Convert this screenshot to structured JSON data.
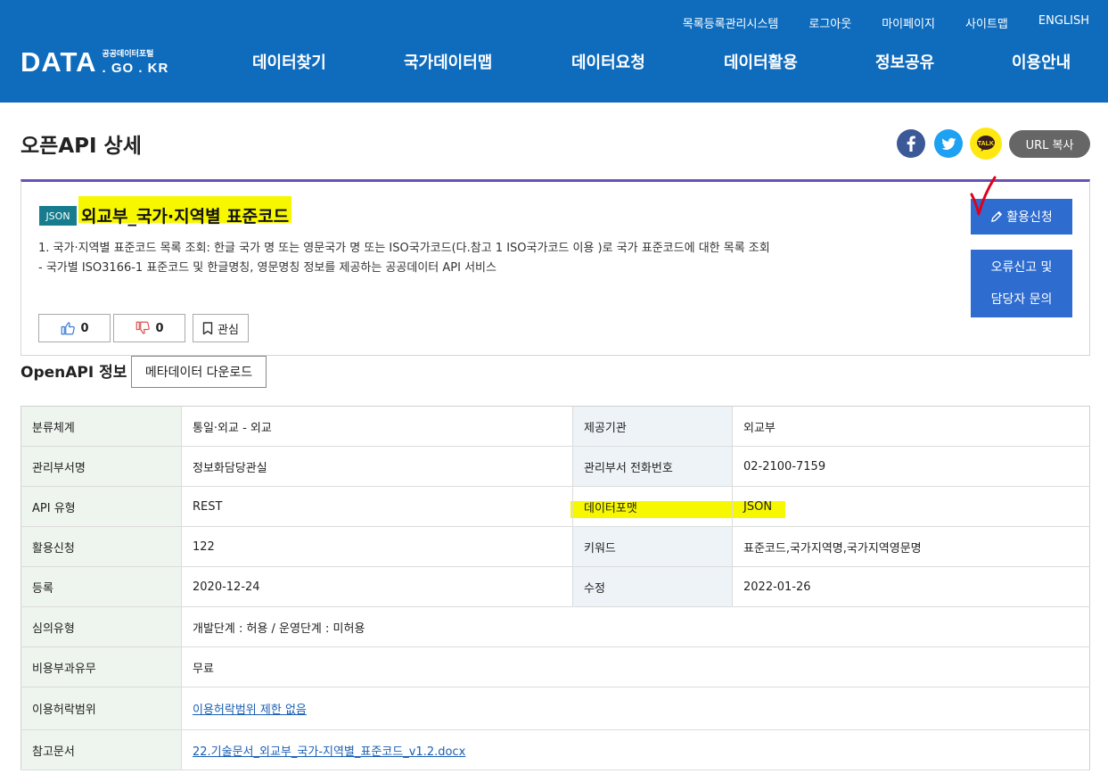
{
  "header": {
    "util_links": [
      "목록등록관리시스템",
      "로그아웃",
      "마이페이지",
      "사이트맵",
      "ENGLISH"
    ],
    "logo_main": "DATA",
    "logo_sub_top": "공공데이터포털",
    "logo_sub_bottom": ". GO . KR",
    "nav": [
      "데이터찾기",
      "국가데이터맵",
      "데이터요청",
      "데이터활용",
      "정보공유",
      "이용안내"
    ]
  },
  "page": {
    "title": "오픈API 상세",
    "kakao_label": "TALK",
    "url_copy": "URL 복사"
  },
  "detail": {
    "format_badge": "JSON",
    "api_title": "외교부_국가·지역별 표준코드",
    "desc_line1": "1. 국가·지역별 표준코드 목록 조회: 한글 국가 명 또는 영문국가 명 또는 ISO국가코드(다.참고 1 ISO국가코드 이용 )로 국가 표준코드에 대한 목록 조회",
    "desc_line2": "- 국가별 ISO3166-1 표준코드 및 한글명칭, 영문명칭 정보를 제공하는 공공데이터 API 서비스",
    "likes": "0",
    "dislikes": "0",
    "favorite": "관심",
    "apply": "활용신청",
    "report_line1": "오류신고 및",
    "report_line2": "담당자 문의"
  },
  "info": {
    "section_title": "OpenAPI 정보",
    "meta_download": "메타데이터 다운로드",
    "rows": [
      {
        "l1": "분류체계",
        "v1": "통일·외교 - 외교",
        "l2": "제공기관",
        "v2": "외교부"
      },
      {
        "l1": "관리부서명",
        "v1": "정보화담당관실",
        "l2": "관리부서 전화번호",
        "v2": "02-2100-7159"
      },
      {
        "l1": "API 유형",
        "v1": "REST",
        "l2": "데이터포맷",
        "v2": "JSON"
      },
      {
        "l1": "활용신청",
        "v1": "122",
        "l2": "키워드",
        "v2": "표준코드,국가지역명,국가지역영문명"
      },
      {
        "l1": "등록",
        "v1": "2020-12-24",
        "l2": "수정",
        "v2": "2022-01-26"
      }
    ],
    "review_label": "심의유형",
    "review_value": "개발단계 : 허용 / 운영단계 : 미허용",
    "fee_label": "비용부과유무",
    "fee_value": "무료",
    "license_label": "이용허락범위",
    "license_value": "이용허락범위 제한 없음",
    "ref_label": "참고문서",
    "ref_value": "22.기술문서_외교부_국가-지역별_표준코드_v1.2.docx"
  },
  "colors": {
    "header_bg": "#0f6cbd",
    "card_border_top": "#6a4fb4",
    "button_blue": "#2e6ccf",
    "badge_teal": "#167c8e",
    "highlight": "#f7f700",
    "annotation_red": "#e0001b"
  }
}
